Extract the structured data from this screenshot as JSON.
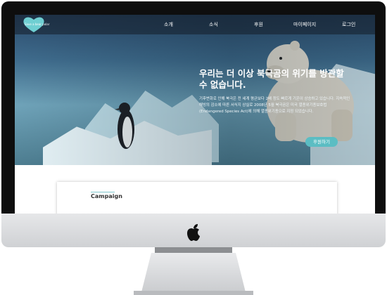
{
  "nav": {
    "logo_text": "Save a bear polar",
    "items": [
      "소개",
      "소식",
      "후원",
      "마이페이지",
      "로그인"
    ]
  },
  "hero": {
    "headline": "우리는 더 이상 북극곰의 위기를 방관할 수 없습니다.",
    "body": "기후변화로 인해 북극은 전 세계 평균보다 2배 정도 빠르게 기온이 상승하고 있습니다. 지속적인 해빙의 감소에 따른 서식지 상실로 2008년 5월 북극곰은 미국 멸종위기종보호법 (Endangered Species Act)에 의해 멸종위기종으로 지정 되었습니다.",
    "donate_label": "후원하기"
  },
  "section": {
    "title": "Campaign"
  },
  "colors": {
    "accent": "#5bbdc3",
    "logo": "#6fcfd2"
  }
}
